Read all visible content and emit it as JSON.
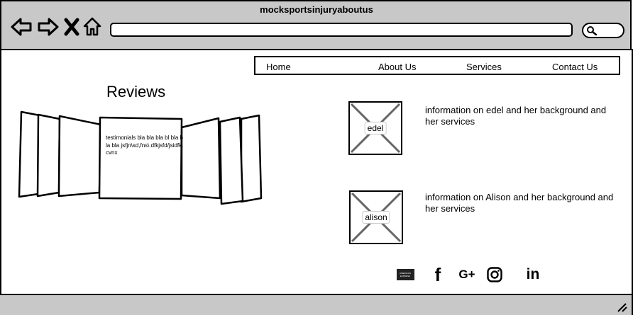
{
  "window": {
    "title": "mocksportsinjuryaboutus"
  },
  "nav": {
    "items": [
      "Home",
      "About Us",
      "Services",
      "Contact Us"
    ]
  },
  "reviews": {
    "title": "Reviews",
    "testimonial": "testimonials bla bla bla bl bla bla bla jsfjn\\sd,fns\\.dfkjsfd/jsidfk.cvnx"
  },
  "staff": [
    {
      "label": "edel",
      "info": "information on edel and her background and her services"
    },
    {
      "label": "alison",
      "info": "information on Alison and her background and her services"
    }
  ],
  "social": {
    "icons": [
      "amex-icon",
      "facebook-icon",
      "google-plus-icon",
      "instagram-icon",
      "linkedin-icon"
    ],
    "glyphs": {
      "facebook": "f",
      "google_plus": "G+",
      "linkedin": "in"
    },
    "amex_text": "AMERICAN EXPRESS"
  },
  "colors": {
    "chrome": "#c8c8c8",
    "stroke": "#000000",
    "placeholder_x": "#666666"
  }
}
